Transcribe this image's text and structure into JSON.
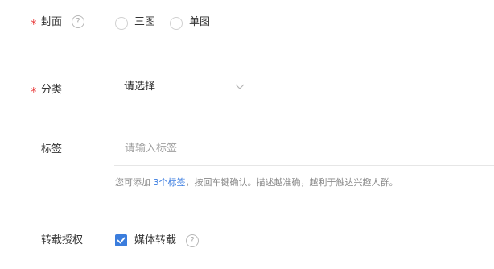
{
  "cover": {
    "required_mark": "*",
    "label": "封面",
    "help_glyph": "?",
    "options": [
      "三图",
      "单图"
    ]
  },
  "category": {
    "required_mark": "*",
    "label": "分类",
    "selected_value": "请选择"
  },
  "tags": {
    "label": "标签",
    "placeholder": "请输入标签",
    "hint_prefix": "您可添加",
    "hint_link": "3个标签",
    "hint_suffix": "，按回车键确认。描述越准确，越利于触达兴趣人群。"
  },
  "repost": {
    "label": "转载授权",
    "checkbox_label": "媒体转载",
    "checked": true,
    "help_glyph": "?"
  },
  "colors": {
    "required": "#e83b3b",
    "accent": "#3b7ddd",
    "link": "#3a7ce0"
  }
}
